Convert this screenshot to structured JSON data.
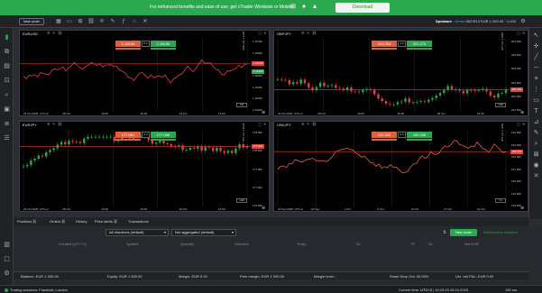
{
  "banner": {
    "message": "For enhanced benefits and ease of use, get cTrader Windows or Mobile",
    "download_label": "Download",
    "os_icons": [
      "windows-icon",
      "apple-icon",
      "android-icon"
    ]
  },
  "topbar": {
    "new_order_label": "New order",
    "account_name": "Spotware",
    "account_type": "Demo",
    "account_id": "5827810",
    "account_summary": "EUR 1 000.00 · 1:100"
  },
  "charts": [
    {
      "symbol": "EURUSD",
      "bid": "1.16154",
      "ask": "1.16158",
      "spread": "0.4",
      "price_tag": "1.16156",
      "price_tag_color": "red",
      "level_tag": "1.16165",
      "level_tag_color": "green",
      "y_axis_label": "USD per 1 EUR",
      "y_ticks": [
        "1.16700",
        "1.16600",
        "1.16500",
        "1.16400",
        "1.16300",
        "1.16200",
        "1.16100"
      ],
      "x_ticks": [
        "24 Oct 2025, UTC+2",
        "28 Oct",
        "16:00",
        "20:00",
        "29 Oct",
        "16:00"
      ],
      "timeframe": "m5",
      "series_color": "#e04040"
    },
    {
      "symbol": "GBPJPY",
      "bid": "201.264",
      "ask": "201.274",
      "spread": "1.0",
      "price_tag": "201.264",
      "price_tag_color": "red",
      "level_tag": "",
      "level_tag_color": "",
      "y_axis_label": "JPY per 1 GBP",
      "y_ticks": [
        "204.000",
        "203.500",
        "203.000",
        "202.500",
        "202.000",
        "201.500"
      ],
      "x_ticks": [
        "24 Oct 2025, UTC+2",
        "28 Oct",
        "16:00",
        "20:00",
        "29 Oct",
        "16:00"
      ],
      "timeframe": "m30",
      "series_color": "#2aa94f"
    },
    {
      "symbol": "EURJPY",
      "bid": "177.061",
      "ask": "177.065",
      "spread": "0.4",
      "price_tag": "177.061",
      "price_tag_color": "red",
      "level_tag": "",
      "level_tag_color": "",
      "y_axis_label": "JPY per 1 EUR",
      "y_ticks": [
        "178.500",
        "178.000",
        "177.500",
        "177.000",
        "176.500"
      ],
      "x_ticks": [
        "24 Oct 2025, UTC+2",
        "28 Oct",
        "16:00",
        "20:00",
        "29 Oct",
        "16:00"
      ],
      "timeframe": "m30",
      "series_color": "#2aa94f"
    },
    {
      "symbol": "USDJPY",
      "bid": "152.342",
      "ask": "152.346",
      "spread": "0.4",
      "price_tag": "152.342",
      "price_tag_color": "red",
      "level_tag": "",
      "level_tag_color": "",
      "y_axis_label": "JPY per 1 USD",
      "y_ticks": [
        "154.000",
        "153.000",
        "152.000",
        "151.000",
        "150.000",
        "149.000",
        "148.000"
      ],
      "x_ticks": [
        "16 Sep 2025, UTC+2",
        "24 Sep",
        "1 Oct",
        "8 Oct",
        "16 Oct",
        "27 Oct",
        "31 Oct"
      ],
      "timeframe": "h4",
      "series_color": "#e06038"
    }
  ],
  "tabs": [
    {
      "label": "Positions",
      "count": "0"
    },
    {
      "label": "Orders",
      "count": "0"
    },
    {
      "label": "History",
      "count": ""
    },
    {
      "label": "Price alerts",
      "count": "0"
    },
    {
      "label": "Transactions",
      "count": ""
    }
  ],
  "filters": {
    "directions": "All directions (default)",
    "aggregation": "Not aggregated (default)"
  },
  "panel": {
    "new_order_label": "New order",
    "add_columns_label": "Add/remove columns"
  },
  "columns": [
    "Created (UTC+2)",
    "Symbol",
    "Quantity",
    "Direction",
    "Entry",
    "SL",
    "TP",
    "SL",
    "Net EUR"
  ],
  "status": {
    "balance": "Balance: EUR 1 000.00",
    "equity": "Equity: EUR 1 000.00",
    "margin": "Margin: EUR 0.00",
    "free_margin": "Free margin: EUR 1 000.00",
    "margin_level": "Margin level: -",
    "smart_stop_out": "Smart Stop Out: 30.00%",
    "unr_net_pl": "Unr. net P&L: EUR 0.00"
  },
  "bottom": {
    "session_text": "Trading sessions: Frankfurt, London",
    "time_label": "Current time:",
    "timezone": "UTC+2",
    "datetime": "10:29:29 28.10.2025",
    "latency": "155 ms"
  }
}
